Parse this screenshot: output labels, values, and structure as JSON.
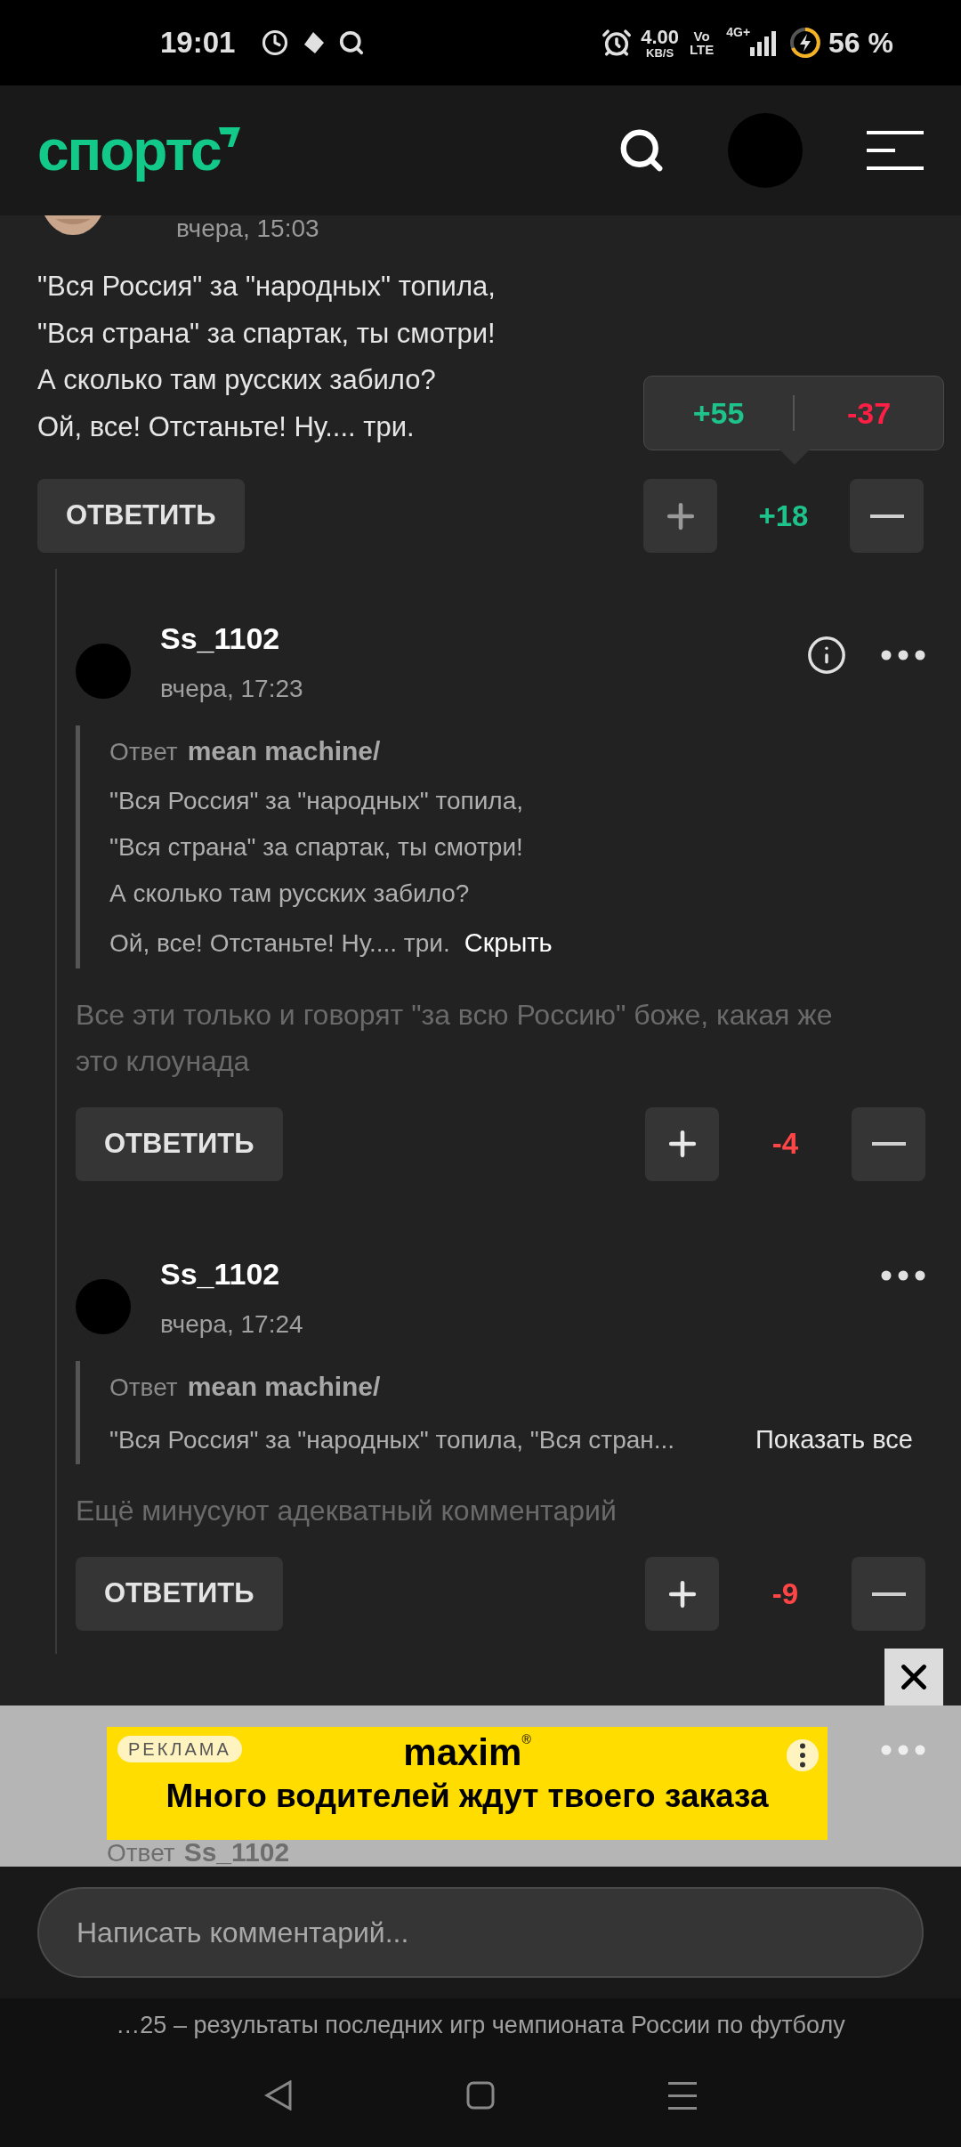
{
  "status_bar": {
    "time": "19:01",
    "net_speed": "4.00",
    "net_unit": "KB/S",
    "volte_top": "Vo",
    "volte_bottom": "LTE",
    "network": "4G+",
    "battery": "56 %"
  },
  "header": {
    "logo": "спортс"
  },
  "comments": [
    {
      "kind": "top",
      "time": "вчера, 15:03",
      "lines": [
        "\"Вся Россия\" за \"народных\" топила,",
        "\"Вся страна\" за спартак, ты смотри!",
        "А сколько там русских забило?",
        "Ой, все! Отстаньте! Ну.... три."
      ],
      "reply_button": "ОТВЕТИТЬ",
      "score": "+18",
      "color": "#1ec28b",
      "tooltip": {
        "up": "+55",
        "down": "-37"
      }
    },
    {
      "kind": "reply",
      "author": "Ss_1102",
      "time": "вчера, 17:23",
      "info": true,
      "quote": {
        "label": "Ответ",
        "author": "mean machine/",
        "expanded": true,
        "lines": [
          "\"Вся Россия\" за \"народных\" топила,",
          "\"Вся страна\" за спартак, ты смотри!",
          "А сколько там русских забило?",
          "Ой, все! Отстаньте! Ну.... три."
        ],
        "toggle": "Скрыть"
      },
      "text": "Все эти только и говорят \"за всю Россию\" боже, какая же это клоунада",
      "reply_button": "ОТВЕТИТЬ",
      "score": "-4",
      "color": "#ff4545"
    },
    {
      "kind": "reply",
      "author": "Ss_1102",
      "time": "вчера, 17:24",
      "info": false,
      "quote": {
        "label": "Ответ",
        "author": "mean machine/",
        "expanded": false,
        "lines": [
          "\"Вся Россия\" за \"народных\" топила, \"Вся стран..."
        ],
        "toggle": "Показать все"
      },
      "text": "Ещё минусуют адекватный комментарий",
      "reply_button": "ОТВЕТИТЬ",
      "score": "-9",
      "color": "#ff4545"
    }
  ],
  "ad": {
    "label": "РЕКЛАМА",
    "brand": "maxim",
    "brand_mark": "®",
    "headline": "Много водителей ждут твоего заказа",
    "behind": {
      "label": "Ответ",
      "author": "Ss_1102"
    }
  },
  "composer": {
    "placeholder": "Написать комментарий..."
  },
  "footer": {
    "text": "…25 – результаты последних игр чемпионата России по футболу"
  }
}
